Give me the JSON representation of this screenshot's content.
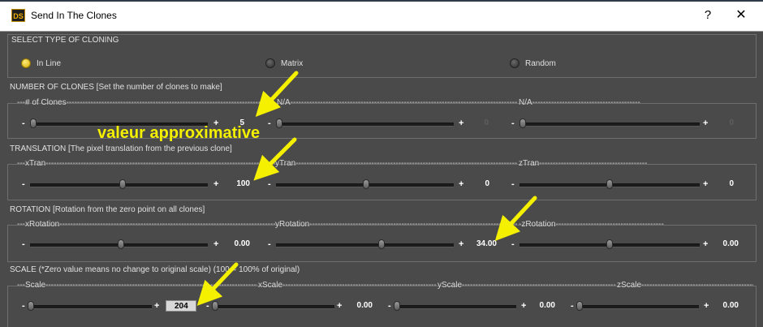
{
  "window": {
    "title": "Send In The Clones",
    "icon_text": "DS",
    "help": "?",
    "close": "✕"
  },
  "cloning_type": {
    "heading": "SELECT TYPE OF CLONING",
    "options": [
      {
        "label": "In Line",
        "selected": true
      },
      {
        "label": "Matrix",
        "selected": false
      },
      {
        "label": "Random",
        "selected": false
      }
    ]
  },
  "number_of_clones": {
    "heading": "NUMBER OF CLONES [Set the number of clones to make]",
    "sliders": [
      {
        "legend": "---# of Clones--------------------------------------------------------------------------------------",
        "value": "5",
        "level": 0
      },
      {
        "legend": "N/A----------------------------------------------------------------------------------------------",
        "value": "0",
        "level": 0
      },
      {
        "legend": "N/A----------------------------------------",
        "value": "0",
        "level": 0
      }
    ]
  },
  "translation": {
    "heading": "TRANSLATION [The pixel translation from the previous clone]",
    "sliders": [
      {
        "legend": "---xTran---------------------------------------------------------------------------------------",
        "value": "100",
        "level": 0.45
      },
      {
        "legend": "yTran----------------------------------------------------------------------------------------------",
        "value": "0",
        "level": 0.45
      },
      {
        "legend": "zTran----------------------------------------",
        "value": "0",
        "level": 0.5
      }
    ]
  },
  "rotation": {
    "heading": "ROTATION [Rotation from the zero point on all clones]",
    "sliders": [
      {
        "legend": "---xRotation---------------------------------------------------------------------------------------",
        "value": "0.00",
        "level": 0.5
      },
      {
        "legend": "yRotation----------------------------------------------------------------------------------------------",
        "value": "34.00",
        "level": 0.56
      },
      {
        "legend": "-zRotation----------------------------------------",
        "value": "0.00",
        "level": 0.5
      }
    ]
  },
  "scale": {
    "heading": "SCALE (*Zero value means no change to original scale) (100 = 100% of original)",
    "sliders": [
      {
        "legend": "---Scale-----------------------------------------------------------------------------------",
        "value": "204",
        "level": 0
      },
      {
        "legend": "xScale---------------------------------------------------------------",
        "value": "0.00",
        "level": 0
      },
      {
        "legend": "yScale---------------------------------------------------------------",
        "value": "0.00",
        "level": 0
      },
      {
        "legend": "zScale--------------------------------------------",
        "value": "0.00",
        "level": 0
      }
    ]
  },
  "annotation": {
    "text": "valeur approximative",
    "color": "#f4f000"
  }
}
